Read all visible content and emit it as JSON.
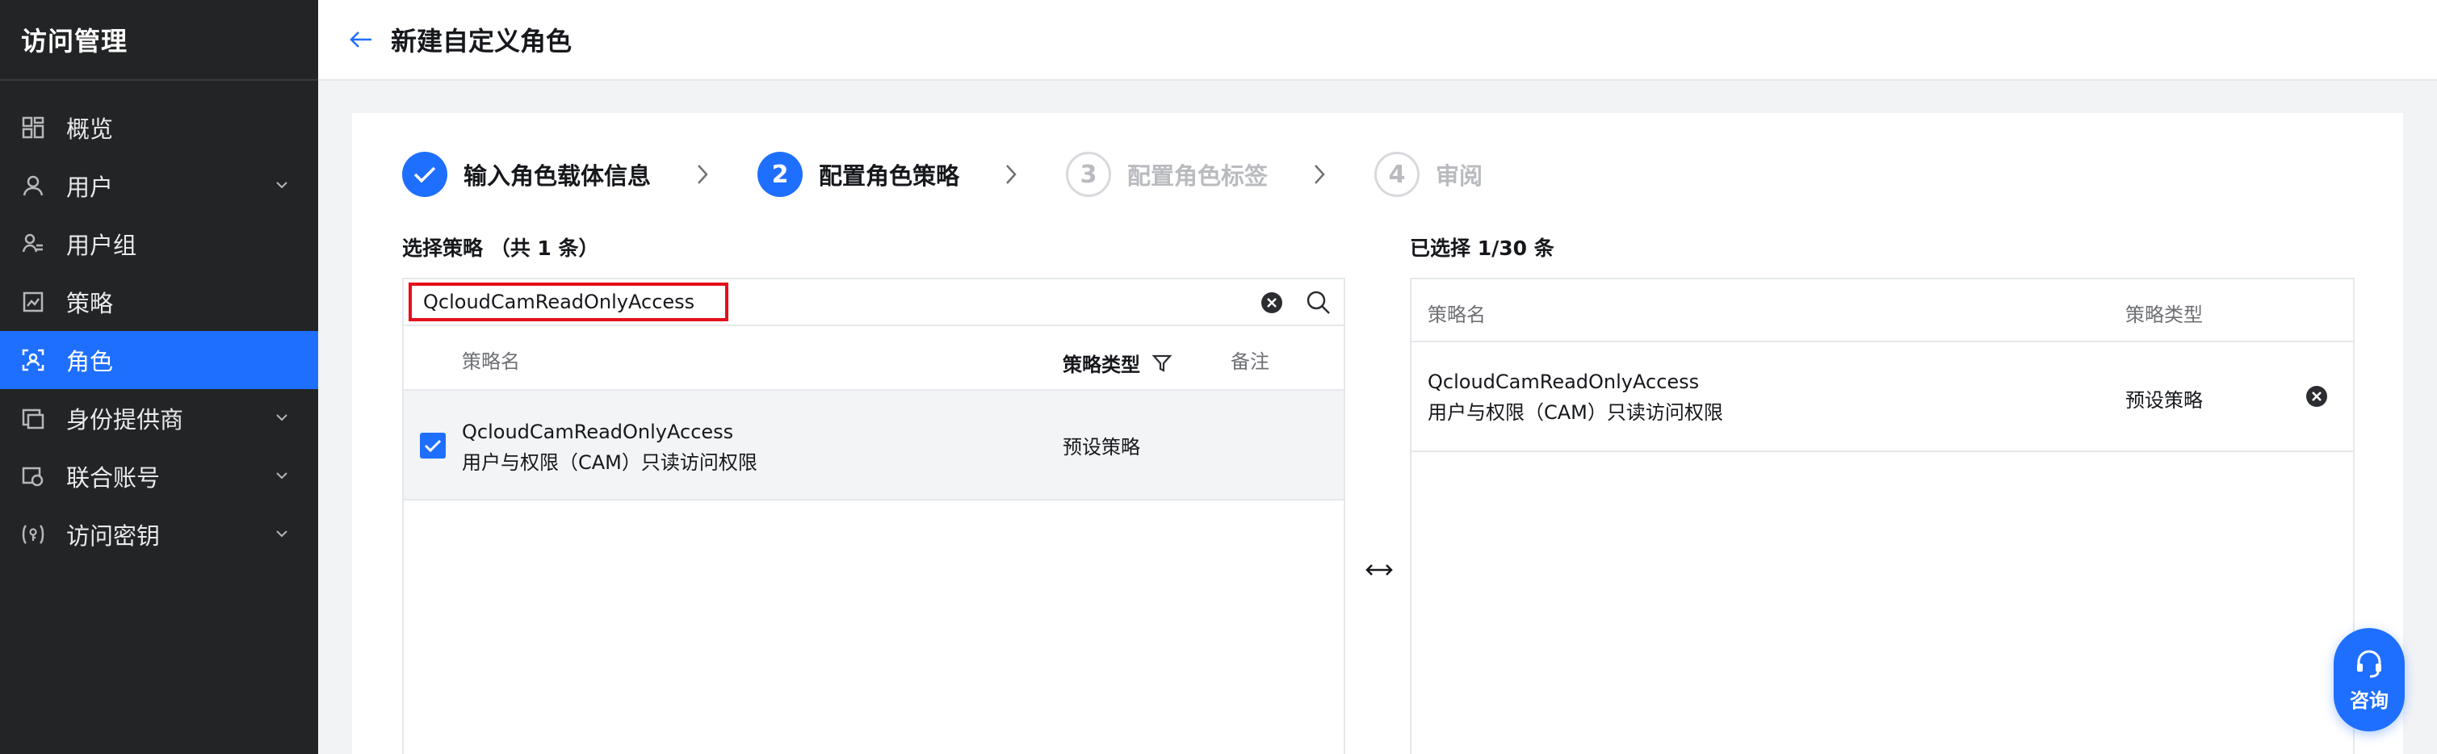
{
  "sidebar": {
    "title": "访问管理",
    "items": [
      {
        "label": "概览",
        "icon": "dashboard-icon"
      },
      {
        "label": "用户",
        "icon": "user-icon"
      },
      {
        "label": "用户组",
        "icon": "user-group-icon"
      },
      {
        "label": "策略",
        "icon": "policy-icon"
      },
      {
        "label": "角色",
        "icon": "role-icon"
      },
      {
        "label": "身份提供商",
        "icon": "identity-provider-icon"
      },
      {
        "label": "联合账号",
        "icon": "federated-account-icon"
      },
      {
        "label": "访问密钥",
        "icon": "access-key-icon"
      }
    ],
    "active_item": "角色"
  },
  "header": {
    "title": "新建自定义角色"
  },
  "steps": [
    {
      "number": "1",
      "label": "输入角色载体信息",
      "state": "done"
    },
    {
      "number": "2",
      "label": "配置角色策略",
      "state": "current"
    },
    {
      "number": "3",
      "label": "配置角色标签",
      "state": "todo"
    },
    {
      "number": "4",
      "label": "审阅",
      "state": "todo"
    }
  ],
  "left_panel": {
    "title": "选择策略 （共 1 条）",
    "search_value": "QcloudCamReadOnlyAccess",
    "columns": {
      "name": "策略名",
      "type": "策略类型",
      "note": "备注"
    },
    "rows": [
      {
        "name": "QcloudCamReadOnlyAccess",
        "description": "用户与权限（CAM）只读访问权限",
        "type": "预设策略",
        "checked": true
      }
    ]
  },
  "right_panel": {
    "title": "已选择 1/30 条",
    "columns": {
      "name": "策略名",
      "type": "策略类型"
    },
    "rows": [
      {
        "name": "QcloudCamReadOnlyAccess",
        "description": "用户与权限（CAM）只读访问权限",
        "type": "预设策略"
      }
    ]
  },
  "consult": {
    "label": "咨询"
  },
  "colors": {
    "accent": "#1f6fff",
    "sidebar_bg": "#232425",
    "highlight_border": "#e3101a"
  }
}
